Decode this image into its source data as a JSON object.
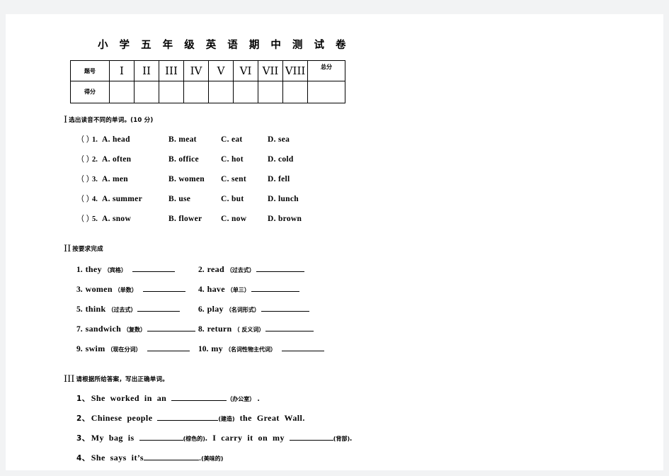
{
  "document": {
    "title": "小 学 五 年 级 英 语 期 中 测 试 卷"
  },
  "score_table": {
    "row_labels": [
      "题号",
      "得分"
    ],
    "total_label": "总分",
    "question_numbers": [
      "I",
      "II",
      "III",
      "IV",
      "V",
      "VI",
      "VII",
      "VIII"
    ],
    "score_values": [
      "",
      "",
      "",
      "",
      "",
      "",
      "",
      "",
      ""
    ]
  },
  "sections": [
    {
      "roman": "I",
      "heading": "选出读音不同的单词。(10 分)",
      "items": [
        {
          "paren": "（  ）",
          "num": "1.",
          "options": [
            "A.  head",
            "B.  meat",
            "C.  eat",
            "D.  sea"
          ]
        },
        {
          "paren": "（  ）",
          "num": "2.",
          "options": [
            "A.  often",
            "B.  office",
            "C.  hot",
            "D.  cold"
          ]
        },
        {
          "paren": "（  ）",
          "num": "3.",
          "options": [
            "A.  men",
            "B.  women",
            "C.  sent",
            "D.  fell"
          ]
        },
        {
          "paren": "（  ）",
          "num": "4.",
          "options": [
            "A.  summer",
            "B.  use",
            "C.  but",
            "D.  lunch"
          ]
        },
        {
          "paren": "（  ）",
          "num": "5.",
          "options": [
            "A.  snow",
            "B.  flower",
            "C.  now",
            "D.  brown"
          ]
        }
      ]
    },
    {
      "roman": "II",
      "heading": "按要求完成",
      "items": [
        {
          "idx": "1.",
          "word": "they",
          "hint": "（宾格）"
        },
        {
          "idx": "2.",
          "word": "read",
          "hint": "（过去式）"
        },
        {
          "idx": "3.",
          "word": "women",
          "hint": "（单数）"
        },
        {
          "idx": "4.",
          "word": "have",
          "hint": "（单三）"
        },
        {
          "idx": "5.",
          "word": "think",
          "hint": "（过去式）"
        },
        {
          "idx": "6.",
          "word": "play",
          "hint": "（名词形式）"
        },
        {
          "idx": "7.",
          "word": "sandwich",
          "hint": "（复数）"
        },
        {
          "idx": "8.",
          "word": "return",
          "hint": "（ 反义词）"
        },
        {
          "idx": "9.",
          "word": "swim",
          "hint": "（现在分词）"
        },
        {
          "idx": "10.",
          "word": "my",
          "hint": "（名词性物主代词）"
        }
      ]
    },
    {
      "roman": "III",
      "heading": "请根据所给答案，写出正确单词。",
      "items": [
        {
          "idx": "1、",
          "pre": "She  worked  in  an  ",
          "hint1": "（办公室）",
          "mid": " .",
          "hint2": "",
          "post": ""
        },
        {
          "idx": "2、",
          "pre": "Chinese  people  ",
          "hint1": "(建造)",
          "mid": "  the  Great  Wall.",
          "hint2": "",
          "post": ""
        },
        {
          "idx": "3、",
          "pre": "My  bag  is  ",
          "hint1": "(棕色的)",
          "mid": ".  I  carry  it  on  my  ",
          "hint2": "(背部)",
          "post": "."
        },
        {
          "idx": "4、",
          "pre": "She  says  it’s",
          "hint1": ".(美味的)",
          "mid": "",
          "hint2": "",
          "post": ""
        }
      ]
    }
  ]
}
